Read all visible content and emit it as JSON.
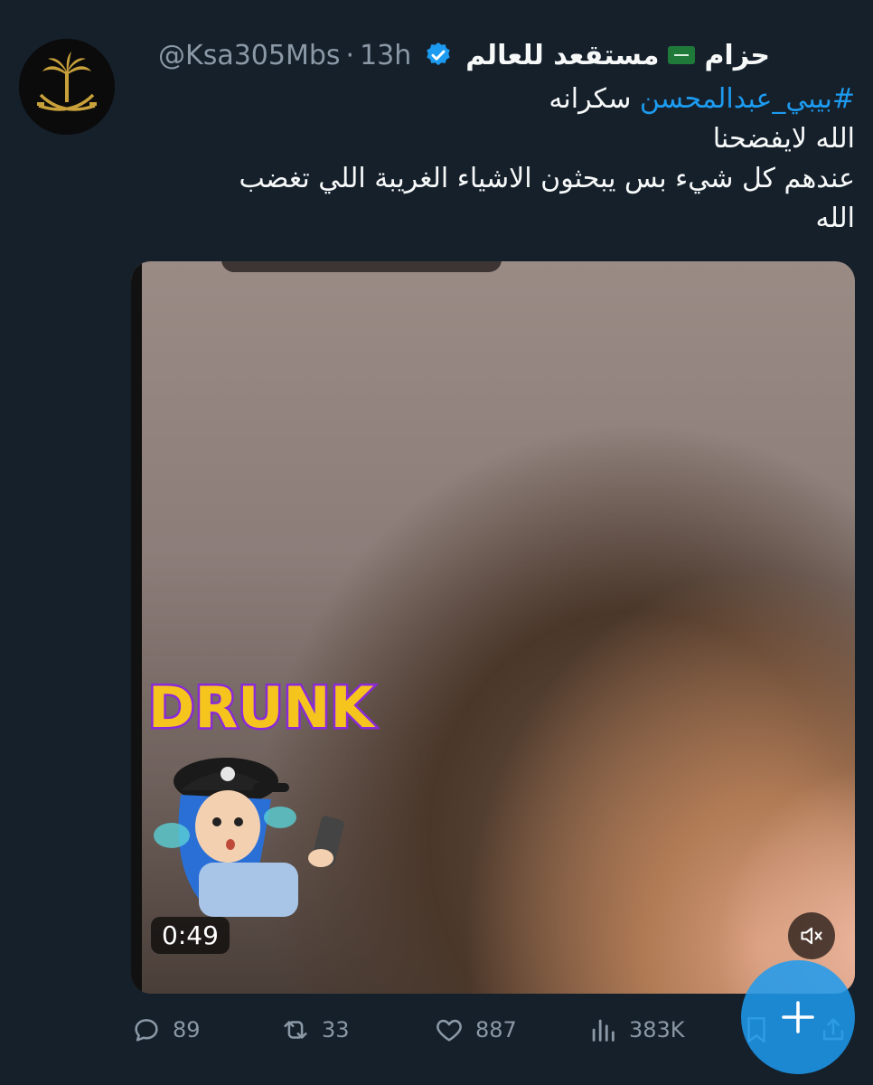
{
  "tweet": {
    "display_name": "مستقعد للعالم",
    "name_suffix": "حزام",
    "handle": "@Ksa305Mbs",
    "separator": "·",
    "time": "13h",
    "hashtag": "#بيبي_عبدالمحسن",
    "line1_tail": "سكرانه",
    "line2": "الله لايفضحنا",
    "line3": "عندهم كل شيء بس يبحثون الاشياء الغريبة  اللي تغضب",
    "line4": "الله"
  },
  "media": {
    "duration": "0:49",
    "sticker_text": "DRUNK"
  },
  "actions": {
    "replies": "89",
    "retweets": "33",
    "likes": "887",
    "views": "383K"
  },
  "icons": {
    "avatar": "saudi-emblem-icon",
    "verified": "verified-badge-icon",
    "flag": "saudi-flag-icon",
    "mute": "mute-icon",
    "reply": "reply-icon",
    "retweet": "retweet-icon",
    "like": "heart-icon",
    "views": "views-icon",
    "bookmark": "bookmark-icon",
    "share": "share-icon",
    "compose": "compose-plus-icon"
  },
  "colors": {
    "background": "#15202b",
    "accent": "#1d9bf0",
    "muted": "#8b98a5"
  }
}
